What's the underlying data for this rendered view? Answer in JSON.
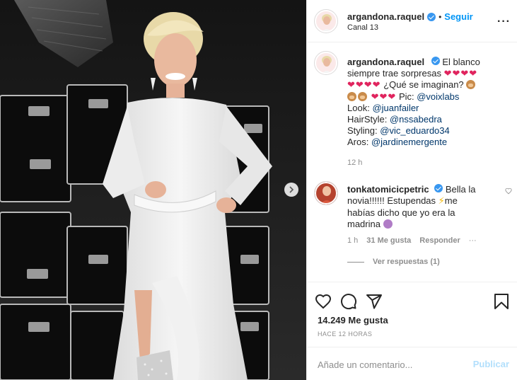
{
  "post": {
    "author": "argandona.raquel",
    "location": "Canal 13",
    "follow_label": "Seguir",
    "separator": "•"
  },
  "caption": {
    "username": "argandona.raquel",
    "line1": "El blanco",
    "line2_text": "siempre trae sorpresas",
    "line2_hearts": "❤❤❤❤",
    "line3_hearts": "❤❤❤❤",
    "line3_text": "¿Qué se imaginan?",
    "line4_hearts": "❤❤❤",
    "line4_text": "Pic:",
    "pic_mention": "@voixlabs",
    "look_label": "Look:",
    "look_mention": "@juanfailer",
    "hair_label": "HairStyle:",
    "hair_mention": "@nssabedra",
    "styling_label": "Styling:",
    "styling_mention": "@vic_eduardo34",
    "aros_label": "Aros:",
    "aros_mention": "@jardinemergente",
    "time": "12 h"
  },
  "comment": {
    "username": "tonkatomicicpetric",
    "line1": "Bella la",
    "line2_a": "novia!!!!!! Estupendas",
    "line2_b": "me",
    "line3": "habías dicho que yo era la",
    "line4": "madrina",
    "time": "1 h",
    "likes": "31 Me gusta",
    "reply_label": "Responder",
    "view_replies": "Ver respuestas (1)"
  },
  "actions": {
    "likes_count": "14.249 Me gusta",
    "time_ago": "HACE 12 HORAS"
  },
  "add_comment": {
    "placeholder": "Añade un comentario...",
    "publish_label": "Publicar"
  },
  "colors": {
    "accent": "#0095f6",
    "verified": "#3897f0",
    "mention": "#00376b",
    "muted": "#8e8e8e",
    "publish_disabled": "#b2dffc",
    "heart": "#e0245e"
  }
}
